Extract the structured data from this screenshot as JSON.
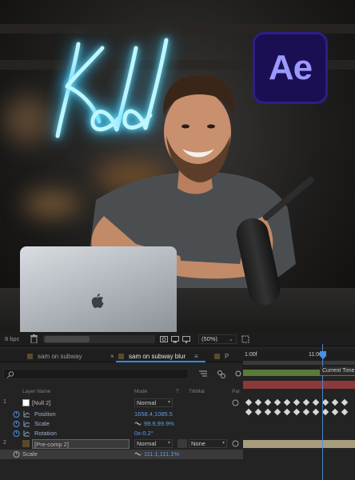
{
  "photo": {
    "neon_sign_text": "Kdd",
    "app_logo": "Ae",
    "colors": {
      "neon": "#bff6ff",
      "ae_bg": "#1a0f52",
      "ae_text": "#9b98ff"
    }
  },
  "viewer_bar": {
    "bit_depth": "8 bpc",
    "zoom": "(50%)",
    "icons": [
      "trash-icon",
      "snapshot-icon",
      "show-snapshot-icon",
      "display-icon",
      "region-icon"
    ]
  },
  "tabs": [
    {
      "label": "sam on subway",
      "active": false,
      "close": "×"
    },
    {
      "label": "sam on subway blur",
      "active": true,
      "menu": "≡"
    },
    {
      "label": "P",
      "active": false
    }
  ],
  "ruler": {
    "start": "1:00f",
    "end": "11:00f"
  },
  "tooltip": "Current Time",
  "columns": {
    "layer_name": "Layer Name",
    "mode": "Mode",
    "t": "T",
    "trkmat": "TrkMat",
    "parent": "Par"
  },
  "layers": [
    {
      "number": "1",
      "name": "[Null 2]",
      "mode": "Normal",
      "properties": [
        {
          "name": "Position",
          "value": "1658.4,1085.5"
        },
        {
          "name": "Scale",
          "value": "99.9,99.9%"
        },
        {
          "name": "Rotation",
          "value": "0x-0.2°"
        }
      ]
    },
    {
      "number": "2",
      "name": "[Pre-comp 2]",
      "mode": "Normal",
      "trkmat": "None",
      "properties": [
        {
          "name": "Scale",
          "value": "111.1,111.1%"
        }
      ]
    }
  ],
  "accent_colors": {
    "blue": "#4d8fe3",
    "red_bar": "#8a3a3a",
    "tan_bar": "#a79c7e"
  }
}
